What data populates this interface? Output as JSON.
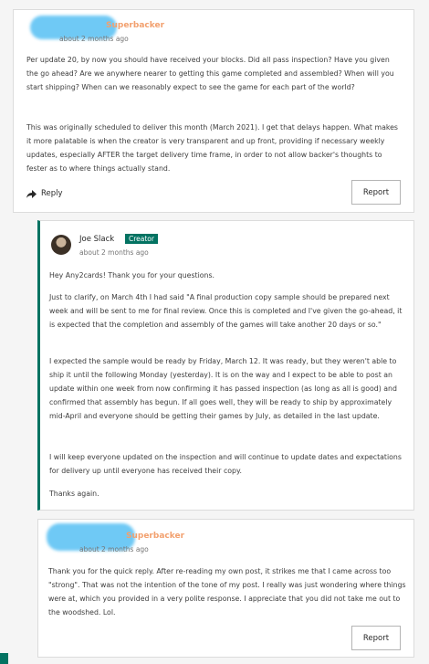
{
  "comment1": {
    "badge": "Superbacker",
    "time": "about 2 months ago",
    "paragraphs": [
      "Per update 20, by now you should have received your blocks. Did all pass inspection? Have you given the go ahead? Are we anywhere nearer to getting this game completed and assembled? When will you start shipping? When can we reasonably expect to see the game for each part of the world?",
      "This was originally scheduled to deliver this month (March 2021). I get that delays happen. What makes it more palatable is when the creator is very transparent and up front, providing if necessary weekly updates, especially AFTER the target delivery time frame, in order to not allow backer's thoughts to fester as to where things actually stand."
    ],
    "reply_label": "Reply",
    "report_label": "Report"
  },
  "comment2": {
    "name": "Joe Slack",
    "badge": "Creator",
    "time": "about 2 months ago",
    "paragraphs": [
      "Hey Any2cards! Thank you for your questions.",
      "Just to clarify, on March 4th I had said \"A final production copy sample should be prepared next week and will be sent to me for final review. Once this is completed and I've given the go-ahead, it is expected that the completion and assembly of the games will take another 20 days or so.\"",
      "I expected the sample would be ready by Friday, March 12. It was ready, but they weren't able to ship it until the following Monday (yesterday). It is on the way and I expect to be able to post an update within one week from now confirming it has passed inspection (as long as all is good) and confirmed that assembly has begun. If all goes well, they will be ready to ship by approximately mid-April and everyone should be getting their games by July, as detailed in the last update.",
      "I will keep everyone updated on the inspection and will continue to update dates and expectations for delivery up until everyone has received their copy.",
      "Thanks again."
    ]
  },
  "comment3": {
    "badge": "Superbacker",
    "time": "about 2 months ago",
    "paragraphs": [
      "Thank you for the quick reply. After re-reading my own post, it strikes me that I came across too \"strong\". That was not the intention of the tone of my post. I really was just wondering where things were at, which you provided in a very polite response. I appreciate that you did not take me out to the woodshed. Lol."
    ],
    "report_label": "Report"
  },
  "colors": {
    "creator_green": "#037362",
    "superbacker_orange": "#f2a06e",
    "redaction_blue": "#6fc9f5"
  }
}
